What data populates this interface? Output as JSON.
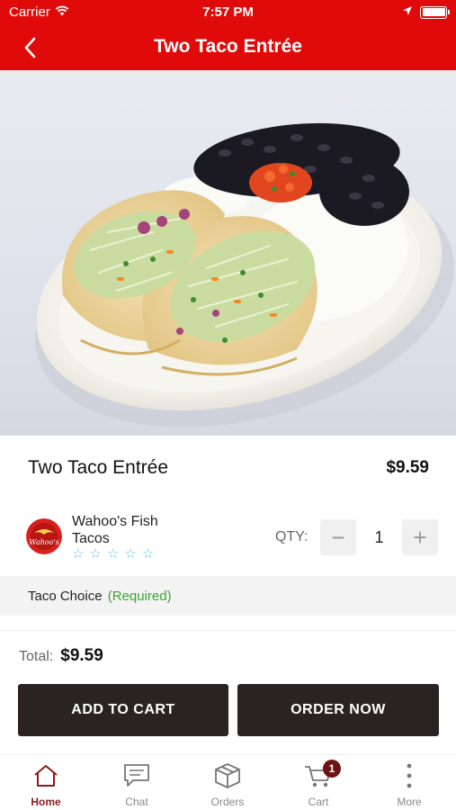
{
  "status_bar": {
    "carrier": "Carrier",
    "time": "7:57 PM"
  },
  "nav": {
    "title": "Two Taco Entrée"
  },
  "item": {
    "name": "Two Taco Entrée",
    "price": "$9.59"
  },
  "store": {
    "name": "Wahoo's Fish Tacos",
    "rating_stars": 0,
    "max_stars": 5,
    "logo_text": "Wahoo's"
  },
  "quantity": {
    "label": "QTY:",
    "value": "1",
    "minus": "−",
    "plus": "+"
  },
  "option": {
    "label": "Taco Choice",
    "required": "(Required)"
  },
  "total": {
    "label": "Total:",
    "value": "$9.59"
  },
  "buttons": {
    "add_to_cart": "ADD TO CART",
    "order_now": "ORDER NOW"
  },
  "tabs": [
    {
      "label": "Home",
      "icon": "home-icon",
      "active": true
    },
    {
      "label": "Chat",
      "icon": "chat-icon"
    },
    {
      "label": "Orders",
      "icon": "box-icon"
    },
    {
      "label": "Cart",
      "icon": "cart-icon",
      "badge": "1"
    },
    {
      "label": "More",
      "icon": "more-icon"
    }
  ],
  "colors": {
    "brand_red": "#e10a0a",
    "button_dark": "#2a2223",
    "required_green": "#3aa435",
    "active_tab": "#8b1c1c",
    "star": "#5ec7e6"
  }
}
